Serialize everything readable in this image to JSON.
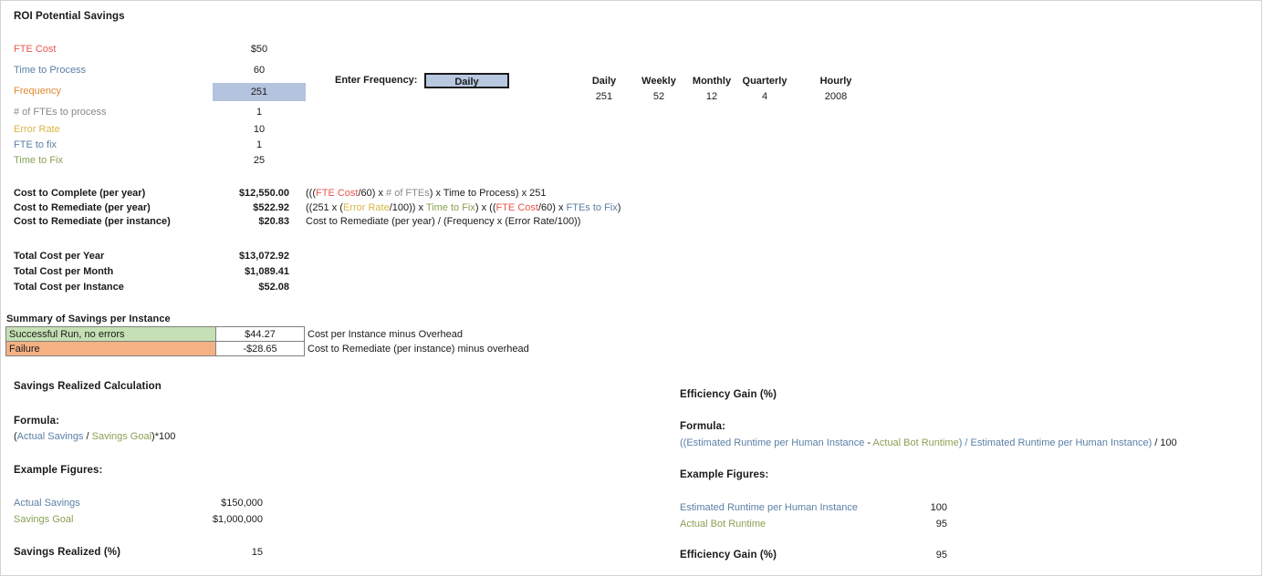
{
  "page": {
    "title": "ROI Potential Savings"
  },
  "inputs": {
    "rows": [
      {
        "label": "FTE Cost",
        "value": "$50",
        "color": "red"
      },
      {
        "label": "Time to Process",
        "value": "60",
        "color": "blue"
      },
      {
        "label": "Frequency",
        "value": "251",
        "color": "orange",
        "highlight": true
      },
      {
        "label": "# of FTEs to process",
        "value": "1",
        "color": "gray"
      }
    ]
  },
  "error_inputs": {
    "rows": [
      {
        "label": "Error Rate",
        "value": "10",
        "color": "gold"
      },
      {
        "label": "FTE to fix",
        "value": "1",
        "color": "blue"
      },
      {
        "label": "Time to Fix",
        "value": "25",
        "color": "olive"
      }
    ]
  },
  "frequency_selector": {
    "label": "Enter Frequency:",
    "selected": "Daily",
    "options": [
      "Daily",
      "Weekly",
      "Monthly",
      "Quarterly",
      "Hourly"
    ]
  },
  "frequency_table": {
    "headers": [
      "Daily",
      "Weekly",
      "Monthly",
      "Quarterly",
      "Hourly"
    ],
    "values": [
      "251",
      "52",
      "12",
      "4",
      "2008"
    ]
  },
  "costs": {
    "rows": [
      {
        "label": "Cost to Complete (per year)",
        "value": "$12,550.00",
        "formula": [
          {
            "t": "(((",
            "c": "dark"
          },
          {
            "t": "FTE Cost",
            "c": "red"
          },
          {
            "t": "/60) x ",
            "c": "dark"
          },
          {
            "t": "# of FTEs",
            "c": "gray"
          },
          {
            "t": ") x ",
            "c": "dark"
          },
          {
            "t": "Time to Process",
            "c": "dark"
          },
          {
            "t": ") x 251",
            "c": "dark"
          }
        ]
      },
      {
        "label": "Cost to Remediate (per year)",
        "value": "$522.92",
        "formula": [
          {
            "t": "((251 x (",
            "c": "dark"
          },
          {
            "t": "Error Rate",
            "c": "gold"
          },
          {
            "t": "/100)) x ",
            "c": "dark"
          },
          {
            "t": "Time to Fix",
            "c": "olive"
          },
          {
            "t": ") x ((",
            "c": "dark"
          },
          {
            "t": "FTE Cost",
            "c": "red"
          },
          {
            "t": "/60) x ",
            "c": "dark"
          },
          {
            "t": "FTEs to Fix",
            "c": "blue"
          },
          {
            "t": ")",
            "c": "dark"
          }
        ]
      },
      {
        "label": "Cost to Remediate (per instance)",
        "value": "$20.83",
        "formula": [
          {
            "t": "Cost to Remediate (per year) / (Frequency x (Error Rate/100))",
            "c": "dark"
          }
        ]
      }
    ]
  },
  "totals": {
    "rows": [
      {
        "label": "Total Cost per Year",
        "value": "$13,072.92"
      },
      {
        "label": "Total Cost per Month",
        "value": "$1,089.41"
      },
      {
        "label": "Total Cost per Instance",
        "value": "$52.08"
      }
    ]
  },
  "summary": {
    "title": "Summary of Savings per Instance",
    "rows": [
      {
        "label": "Successful Run, no errors",
        "value": "$44.27",
        "note": "Cost per Instance minus Overhead",
        "style": "green"
      },
      {
        "label": "Failure",
        "value": "-$28.65",
        "note": "Cost to Remediate (per instance) minus overhead",
        "style": "orange"
      }
    ]
  },
  "savings_realized": {
    "title": "Savings Realized Calculation",
    "formula_heading": "Formula:",
    "formula": [
      {
        "t": "(",
        "c": "dark"
      },
      {
        "t": "Actual Savings",
        "c": "blue"
      },
      {
        "t": " / ",
        "c": "dark"
      },
      {
        "t": "Savings Goal",
        "c": "olive"
      },
      {
        "t": ")*100",
        "c": "dark"
      }
    ],
    "example_heading": "Example Figures:",
    "figures": [
      {
        "label": "Actual Savings",
        "value": "$150,000",
        "color": "blue"
      },
      {
        "label": "Savings Goal",
        "value": "$1,000,000",
        "color": "olive"
      }
    ],
    "result_label": "Savings Realized (%)",
    "result_value": "15"
  },
  "efficiency_gain": {
    "title": "Efficiency Gain (%)",
    "formula_heading": "Formula:",
    "formula": [
      {
        "t": "((",
        "c": "blue"
      },
      {
        "t": "Estimated Runtime per Human Instance",
        "c": "blue"
      },
      {
        "t": " - ",
        "c": "dark"
      },
      {
        "t": "Actual Bot Runtime",
        "c": "olive"
      },
      {
        "t": ") / ",
        "c": "blue"
      },
      {
        "t": "Estimated Runtime per Human Instance",
        "c": "blue"
      },
      {
        "t": ")",
        "c": "blue"
      },
      {
        "t": " / 100",
        "c": "dark"
      }
    ],
    "example_heading": "Example Figures:",
    "figures": [
      {
        "label": "Estimated Runtime per Human Instance",
        "value": "100",
        "color": "blue"
      },
      {
        "label": "Actual Bot Runtime",
        "value": "95",
        "color": "olive"
      }
    ],
    "result_label": "Efficiency Gain (%)",
    "result_value": "95"
  }
}
